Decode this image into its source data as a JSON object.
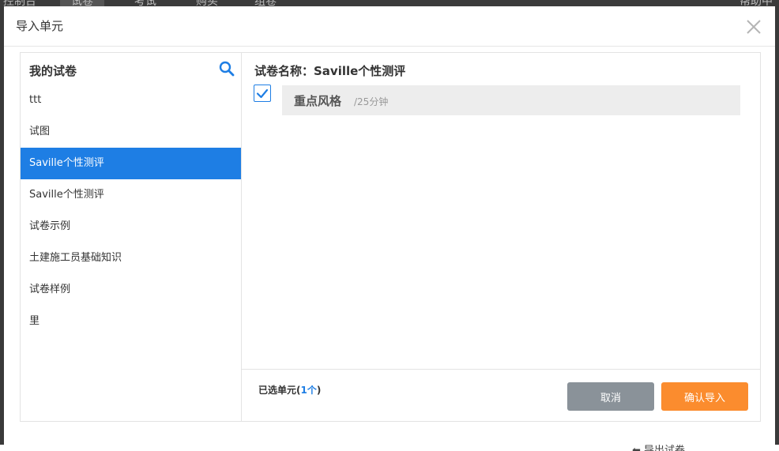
{
  "modal": {
    "title": "导入单元"
  },
  "left": {
    "title": "我的试卷",
    "papers": [
      "ttt",
      "试图",
      "Saville个性测评",
      "Saville个性测评",
      "试卷示例",
      "土建施工员基础知识",
      "试卷样例",
      "里"
    ],
    "selected_index": 2
  },
  "right": {
    "paper_name": "试卷名称：Saville个性测评",
    "units": [
      {
        "name": "重点风格",
        "duration": "/25分钟",
        "checked": true
      }
    ]
  },
  "footer": {
    "selected_prefix": "已选单元(",
    "selected_count": "1个",
    "selected_suffix": ")",
    "cancel_label": "取消",
    "confirm_label": "确认导入"
  },
  "colors": {
    "accent": "#1e7ee4",
    "confirm": "#fb8c2e",
    "cancel": "#8a9299"
  }
}
